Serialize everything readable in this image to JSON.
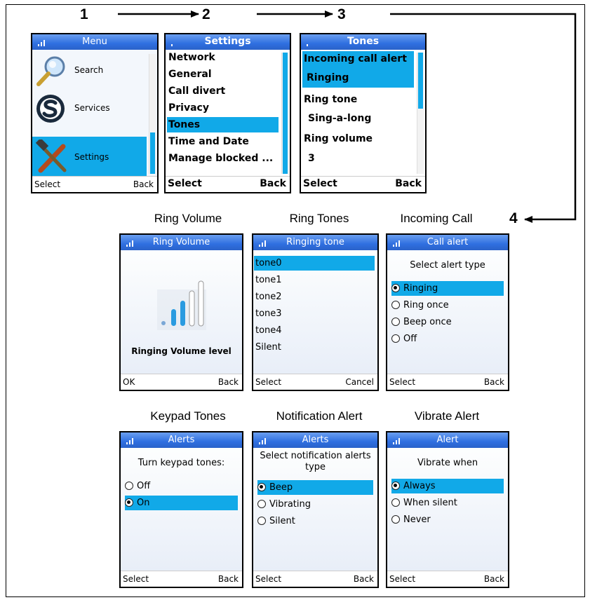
{
  "steps": {
    "s1": "1",
    "s2": "2",
    "s3": "3",
    "s4": "4"
  },
  "captions": {
    "ring_volume": "Ring Volume",
    "ring_tones": "Ring Tones",
    "incoming_call": "Incoming Call",
    "keypad_tones": "Keypad Tones",
    "notification_alert": "Notification Alert",
    "vibrate_alert": "Vibrate Alert"
  },
  "menu": {
    "title": "Menu",
    "items": [
      "Search",
      "Services",
      "Settings"
    ],
    "selected": "Settings",
    "soft_left": "Select",
    "soft_right": "Back"
  },
  "settings": {
    "title": "Settings",
    "items": [
      "Network",
      "General",
      "Call divert",
      "Privacy",
      "Tones",
      "Time and Date",
      "Manage blocked ..."
    ],
    "selected": "Tones",
    "soft_left": "Select",
    "soft_right": "Back"
  },
  "tones": {
    "title": "Tones",
    "items": [
      "Incoming call alert",
      "Ringing",
      "Ring tone",
      "Sing-a-long",
      "Ring volume",
      "3"
    ],
    "soft_left": "Select",
    "soft_right": "Back"
  },
  "ring_volume": {
    "title": "Ring Volume",
    "label": "Ringing Volume level",
    "level_fraction": 0.75,
    "soft_left": "OK",
    "soft_right": "Back"
  },
  "ring_tones": {
    "title": "Ringing tone",
    "items": [
      "tone0",
      "tone1",
      "tone2",
      "tone3",
      "tone4",
      "Silent"
    ],
    "selected": "tone0",
    "soft_left": "Select",
    "soft_right": "Cancel"
  },
  "call_alert": {
    "title": "Call alert",
    "prompt": "Select alert type",
    "options": [
      "Ringing",
      "Ring once",
      "Beep once",
      "Off"
    ],
    "selected": "Ringing",
    "soft_left": "Select",
    "soft_right": "Back"
  },
  "keypad": {
    "title": "Alerts",
    "prompt": "Turn keypad tones:",
    "options": [
      "Off",
      "On"
    ],
    "selected": "On",
    "soft_left": "Select",
    "soft_right": "Back"
  },
  "notification": {
    "title": "Alerts",
    "prompt_line1": "Select notification alerts",
    "prompt_line2": "type",
    "options": [
      "Beep",
      "Vibrating",
      "Silent"
    ],
    "selected": "Beep",
    "soft_left": "Select",
    "soft_right": "Back"
  },
  "vibrate": {
    "title": "Alert",
    "prompt": "Vibrate when",
    "options": [
      "Always",
      "When silent",
      "Never"
    ],
    "selected": "Always",
    "soft_left": "Select",
    "soft_right": "Back"
  },
  "colors": {
    "title_bar": "#2f6fe0",
    "highlight": "#11a9e8"
  },
  "icons": [
    "signal-icon",
    "magnifier-icon",
    "skype-icon",
    "tools-icon",
    "volume-bars-icon"
  ]
}
